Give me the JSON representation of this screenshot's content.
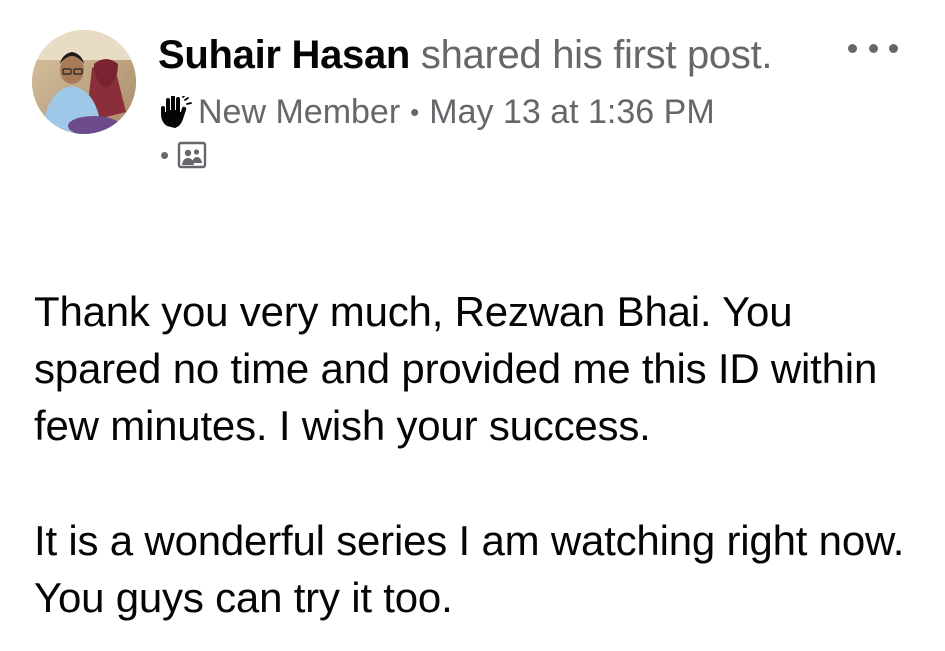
{
  "post": {
    "author": "Suhair Hasan",
    "action": "shared his first post.",
    "badge_label": "New Member",
    "timestamp": "May 13 at 1:36 PM",
    "badge_icon": "waving-hand-icon",
    "privacy_icon": "group-photo-icon",
    "more_icon": "more-options-icon",
    "paragraphs": [
      "Thank you very much, Rezwan Bhai. You spared no time and provided me this ID within few minutes. I wish your success.",
      "It is a wonderful series I am watching right now. You guys can try it too."
    ]
  },
  "colors": {
    "primary_text": "#050505",
    "secondary_text": "#65676b",
    "background": "#ffffff"
  }
}
